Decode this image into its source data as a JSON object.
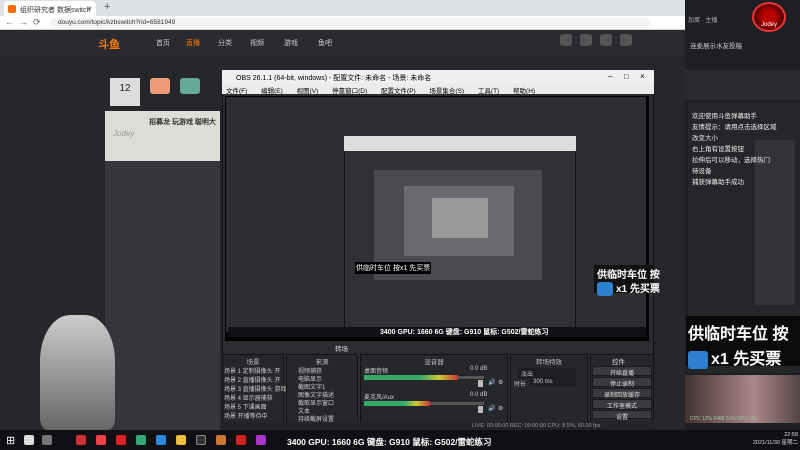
{
  "browser": {
    "tab_title": "组织研究者 数据switch",
    "url": "douyu.com/topic/kzbswitch?rid=6581949"
  },
  "site": {
    "logo": "斗鱼",
    "nav": [
      "首页",
      "直播",
      "分类",
      "视频",
      "游戏",
      "鱼吧"
    ],
    "viewer_count": "12",
    "room_title": "招募龙 玩游戏 聪明大",
    "streamer_name": "Jodey"
  },
  "obs": {
    "title": "OBS 26.1.1 (64-bit, windows) - 配置文件: 未命名 - 场景: 未命名",
    "menu": [
      "文件(F)",
      "编辑(E)",
      "视图(V)",
      "停靠窗口(D)",
      "配置文件(P)",
      "场景集合(S)",
      "工具(T)",
      "帮助(H)"
    ],
    "scene_transition_label": "转场",
    "docks": {
      "scenes_header": "场景",
      "sources_header": "来源",
      "mixer_header": "混音器",
      "transitions_header": "转场特效",
      "controls_header": "控件"
    },
    "scenes": [
      "场景 1 定制摄像头 开",
      "场景 2 直播摄像头 开",
      "场景 3 直播摄像头 游戏",
      "场景 4 显示器捕获",
      "场景 5 下课画面",
      "场景 开播等待中"
    ],
    "sources": [
      "视频捕获",
      "电脑显示",
      "截图文字1",
      "图像文字描述",
      "截取显示窗口",
      "文本",
      "持续截屏设置"
    ],
    "mixer": [
      {
        "name": "桌面音频",
        "db": "0.0 dB",
        "level": 0.78
      },
      {
        "name": "麦克风/Aux",
        "db": "0.0 dB",
        "level": 0.55
      }
    ],
    "transition": {
      "type": "淡出",
      "duration_label": "时长",
      "duration": "300 ms"
    },
    "controls": [
      "开始直播",
      "停止录制",
      "录制回放缓存",
      "工作室模式",
      "设置",
      "退出"
    ],
    "status": "LIVE: 00:00:00   REC: 00:00:00   CPU: 8.5%, 60.00 fps"
  },
  "overlay": {
    "banner_line1": "供临时车位 按",
    "banner_line2": "x1 先买票",
    "big_line1": "供临时车位 按",
    "big_line2": "x1 先买票",
    "preview_mini_text": "供临时车位 按x1 先买票",
    "hardware_info": "3400 GPU: 1660 6G 键盘: G910 鼠标: G502/雷蛇练习"
  },
  "chat": {
    "avatar_label": "Jodey",
    "top_note": "加蛋 · 主播",
    "header_note": "连麦展示水友投稿",
    "lines": [
      "欢迎使用斗鱼弹幕助手",
      "友情提示：请用点击选择区域",
      "改变大小",
      "右上角有设置按钮",
      "拉伸后可以移动，选择热门",
      "待设备",
      "捕获弹幕助手成功"
    ]
  },
  "taskbar": {
    "time": "22:58",
    "date": "2021/11/30 星期二",
    "stats": "CPU 12%  RAM 51%  GPU 1% "
  },
  "colors": {
    "accent": "#ff7a00",
    "obs_bg": "#2b2c30",
    "live_badge": "#2d7fd0"
  }
}
